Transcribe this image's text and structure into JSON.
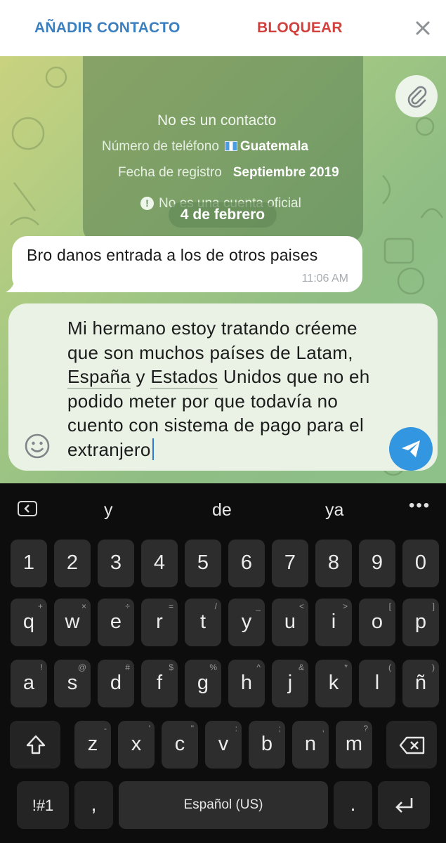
{
  "topbar": {
    "add_contact": "AÑADIR CONTACTO",
    "block": "BLOQUEAR",
    "close_icon": "close-icon"
  },
  "info_card": {
    "not_contact": "No es un contacto",
    "phone_label": "Número de teléfono",
    "phone_value": "Guatemala",
    "reg_label": "Fecha de registro",
    "reg_value": "Septiembre 2019",
    "official": "No es una cuenta oficial"
  },
  "date_separator": "4 de febrero",
  "message": {
    "text": "Bro danos entrada a los de otros paises",
    "time": "11:06 AM"
  },
  "composer": {
    "lines": [
      "Mi hermano estoy tratando créeme",
      "que son muchos países de Latam,",
      "España y Estados Unidos que no eh",
      "podido meter por que todavía no",
      "cuento con sistema de pago para el",
      "extranjero"
    ],
    "underlined": [
      "España",
      "Estados"
    ]
  },
  "keyboard": {
    "suggestions": [
      "y",
      "de",
      "ya"
    ],
    "numbers": [
      "1",
      "2",
      "3",
      "4",
      "5",
      "6",
      "7",
      "8",
      "9",
      "0"
    ],
    "row1": [
      {
        "k": "q",
        "s": "+"
      },
      {
        "k": "w",
        "s": "×"
      },
      {
        "k": "e",
        "s": "÷"
      },
      {
        "k": "r",
        "s": "="
      },
      {
        "k": "t",
        "s": "/"
      },
      {
        "k": "y",
        "s": "_"
      },
      {
        "k": "u",
        "s": "<"
      },
      {
        "k": "i",
        "s": ">"
      },
      {
        "k": "o",
        "s": "["
      },
      {
        "k": "p",
        "s": "]"
      }
    ],
    "row2": [
      {
        "k": "a",
        "s": "!"
      },
      {
        "k": "s",
        "s": "@"
      },
      {
        "k": "d",
        "s": "#"
      },
      {
        "k": "f",
        "s": "$"
      },
      {
        "k": "g",
        "s": "%"
      },
      {
        "k": "h",
        "s": "^"
      },
      {
        "k": "j",
        "s": "&"
      },
      {
        "k": "k",
        "s": "*"
      },
      {
        "k": "l",
        "s": "("
      },
      {
        "k": "ñ",
        "s": ")"
      }
    ],
    "row3": [
      {
        "k": "z",
        "s": "-"
      },
      {
        "k": "x",
        "s": "'"
      },
      {
        "k": "c",
        "s": "\""
      },
      {
        "k": "v",
        "s": ":"
      },
      {
        "k": "b",
        "s": ";"
      },
      {
        "k": "n",
        "s": ","
      },
      {
        "k": "m",
        "s": "?"
      }
    ],
    "sym_key": "!#1",
    "comma_key": ",",
    "space_label": "Español (US)",
    "period_key": "."
  }
}
